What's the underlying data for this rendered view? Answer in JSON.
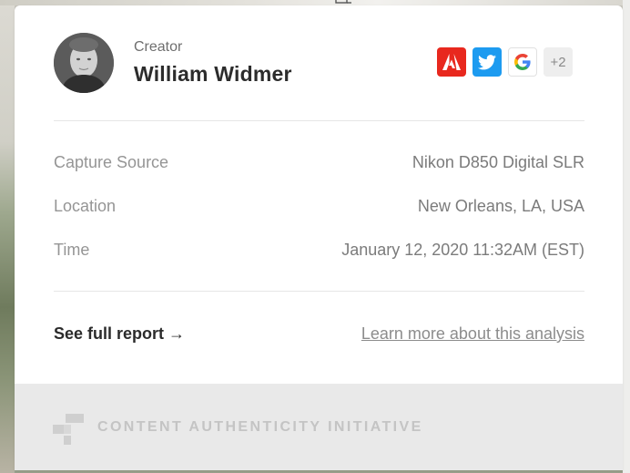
{
  "creator": {
    "label": "Creator",
    "name": "William Widmer",
    "avatar_icon": "person-photo",
    "socials": [
      {
        "icon": "adobe-icon",
        "color": "#e8281e"
      },
      {
        "icon": "twitter-icon",
        "color": "#1d9bf0"
      },
      {
        "icon": "google-icon",
        "color": "#4285f4"
      }
    ],
    "more_count": "+2"
  },
  "details": [
    {
      "label": "Capture Source",
      "value": "Nikon D850 Digital SLR"
    },
    {
      "label": "Location",
      "value": "New Orleans, LA, USA"
    },
    {
      "label": "Time",
      "value": "January 12, 2020 11:32AM (EST)"
    }
  ],
  "actions": {
    "report_label": "See full report →",
    "learn_label": "Learn more about this analysis"
  },
  "footer": {
    "brand": "CONTENT AUTHENTICITY INITIATIVE",
    "logo_icon": "cai-logo-icon"
  }
}
